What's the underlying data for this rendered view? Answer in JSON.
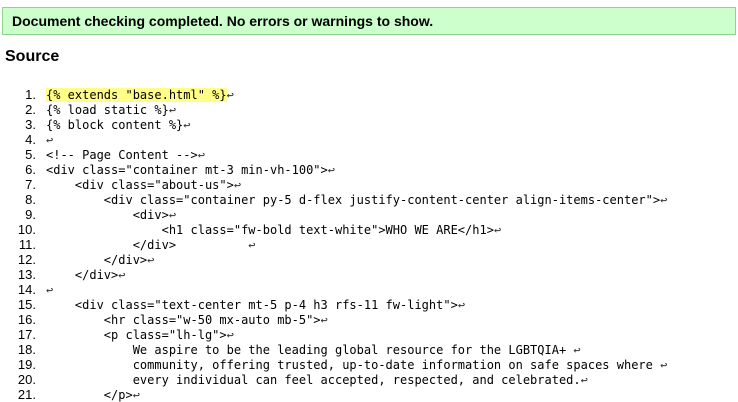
{
  "banner": {
    "message": "Document checking completed. No errors or warnings to show."
  },
  "source": {
    "heading": "Source",
    "newline_glyph": "↩",
    "lines": [
      {
        "num": "1.",
        "code": "{% extends \"base.html\" %}",
        "highlight": true
      },
      {
        "num": "2.",
        "code": "{% load static %}"
      },
      {
        "num": "3.",
        "code": "{% block content %}"
      },
      {
        "num": "4.",
        "code": ""
      },
      {
        "num": "5.",
        "code": "<!-- Page Content -->"
      },
      {
        "num": "6.",
        "code": "<div class=\"container mt-3 min-vh-100\">"
      },
      {
        "num": "7.",
        "code": "    <div class=\"about-us\">"
      },
      {
        "num": "8.",
        "code": "        <div class=\"container py-5 d-flex justify-content-center align-items-center\">"
      },
      {
        "num": "9.",
        "code": "            <div>"
      },
      {
        "num": "10.",
        "code": "                <h1 class=\"fw-bold text-white\">WHO WE ARE</h1>"
      },
      {
        "num": "11.",
        "code": "            </div>          "
      },
      {
        "num": "12.",
        "code": "        </div>"
      },
      {
        "num": "13.",
        "code": "    </div>"
      },
      {
        "num": "14.",
        "code": ""
      },
      {
        "num": "15.",
        "code": "    <div class=\"text-center mt-5 p-4 h3 rfs-11 fw-light\">"
      },
      {
        "num": "16.",
        "code": "        <hr class=\"w-50 mx-auto mb-5\">"
      },
      {
        "num": "17.",
        "code": "        <p class=\"lh-lg\">"
      },
      {
        "num": "18.",
        "code": "            We aspire to be the leading global resource for the LGBTQIA+ "
      },
      {
        "num": "19.",
        "code": "            community, offering trusted, up-to-date information on safe spaces where "
      },
      {
        "num": "20.",
        "code": "            every individual can feel accepted, respected, and celebrated."
      },
      {
        "num": "21.",
        "code": "        </p>"
      }
    ]
  }
}
